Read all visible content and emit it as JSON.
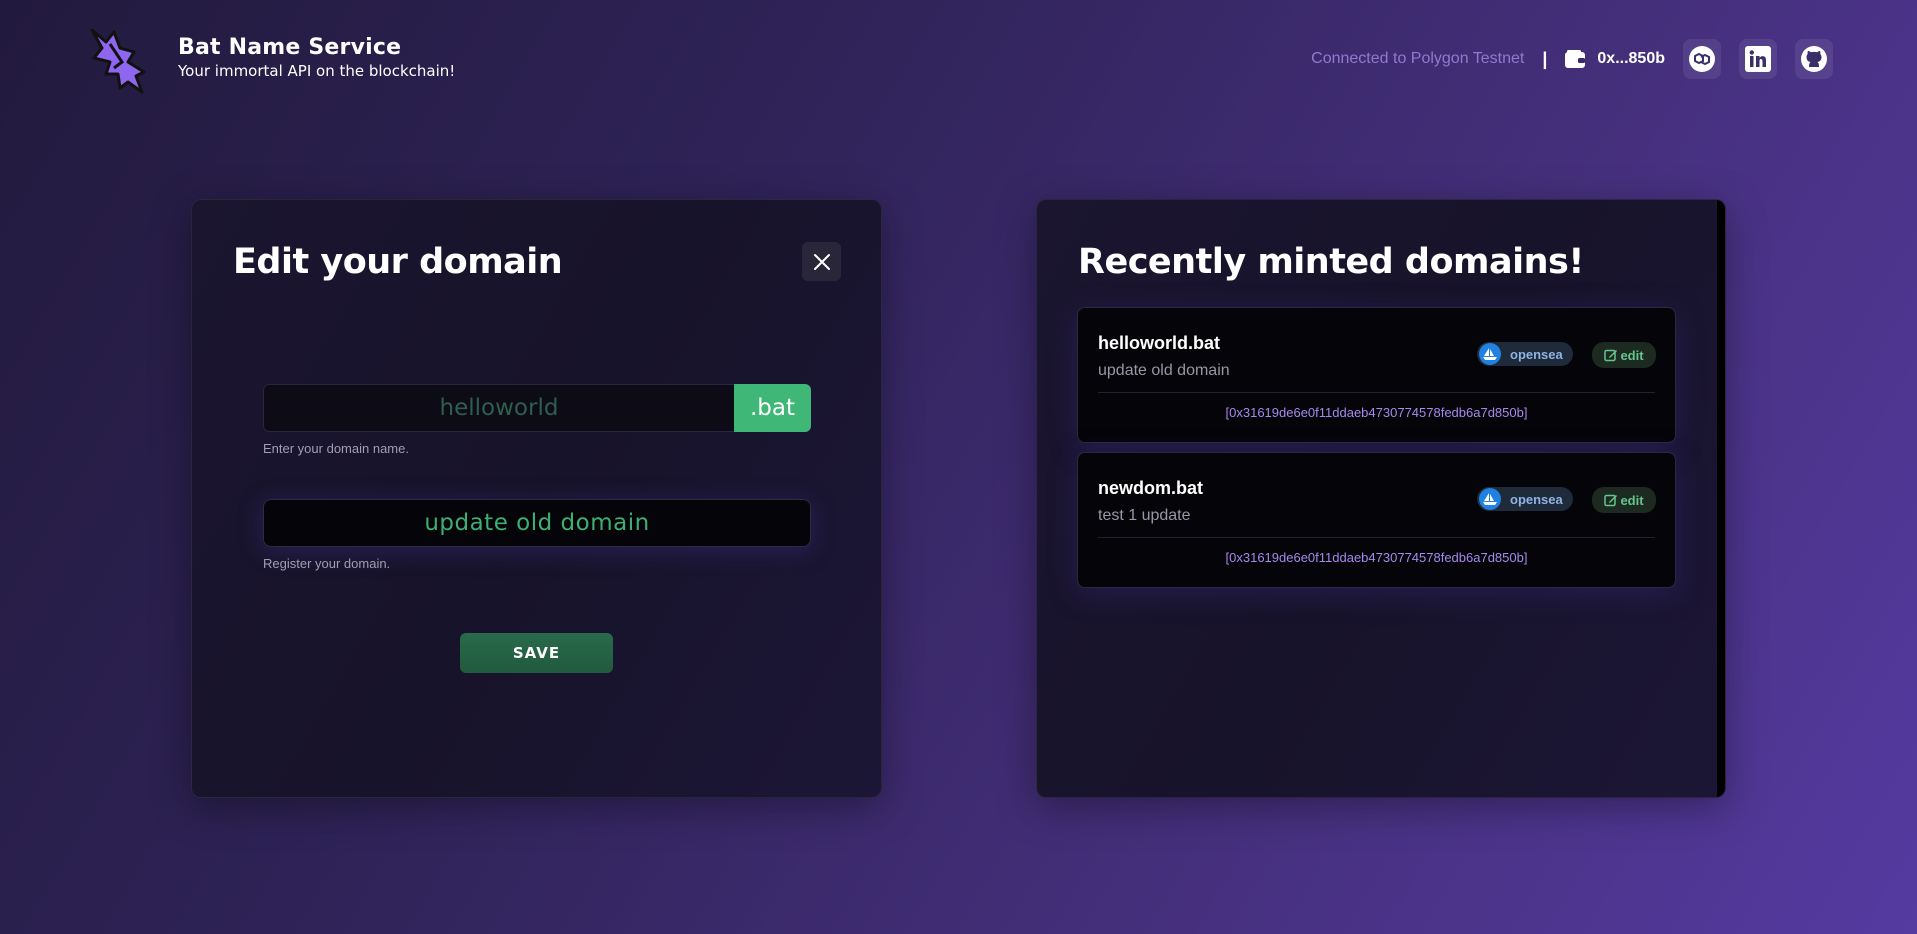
{
  "header": {
    "title": "Bat Name Service",
    "subtitle": "Your immortal API on the blockchain!",
    "network": "Connected to Polygon Testnet",
    "separator": "|",
    "wallet_address": "0x...850b",
    "social": [
      "polygon-icon",
      "linkedin-icon",
      "github-icon"
    ]
  },
  "edit_card": {
    "title": "Edit your domain",
    "domain_value": "helloworld",
    "domain_suffix": ".bat",
    "domain_help": "Enter your domain name.",
    "record_value": "update old domain",
    "record_help": "Register your domain.",
    "save_label": "SAVE"
  },
  "recent_card": {
    "title": "Recently minted domains!",
    "opensea_label": "opensea",
    "edit_label": "edit",
    "items": [
      {
        "name": "helloworld.bat",
        "record": "update old domain",
        "owner": "[0x31619de6e0f11ddaeb4730774578fedb6a7d850b]"
      },
      {
        "name": "newdom.bat",
        "record": "test 1 update",
        "owner": "[0x31619de6e0f11ddaeb4730774578fedb6a7d850b]"
      }
    ]
  },
  "colors": {
    "accent_green": "#3fb877",
    "link_purple": "#a888ec",
    "opensea_blue": "#2081e2"
  }
}
